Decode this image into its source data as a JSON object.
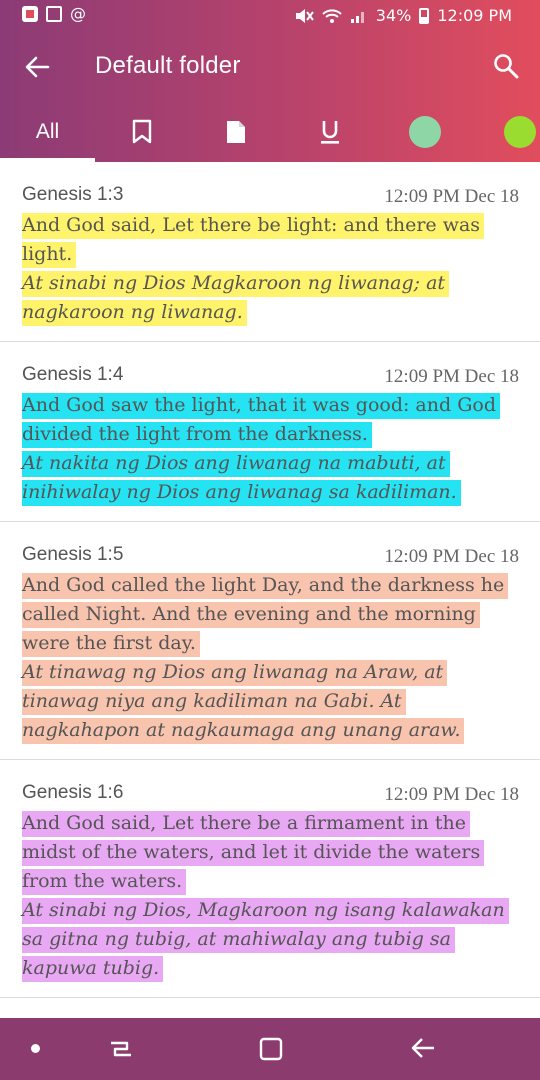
{
  "status_bar": {
    "battery_percent": "34%",
    "time": "12:09 PM"
  },
  "app_bar": {
    "title": "Default folder",
    "back_icon": "arrow-left-icon",
    "search_icon": "search-icon"
  },
  "tabs": {
    "all_label": "All",
    "items": [
      {
        "icon": "bookmark-icon"
      },
      {
        "icon": "note-icon"
      },
      {
        "icon": "underline-icon"
      },
      {
        "icon": "green-highlight-filter",
        "color": "#8fd6a6"
      },
      {
        "icon": "lime-highlight-filter",
        "color": "#9bdc31"
      }
    ]
  },
  "colors": {
    "header_left": "#8c3b76",
    "header_right": "#e14d5d",
    "navbar": "#8c3b6f"
  },
  "entries": [
    {
      "ref": "Genesis 1:3",
      "time": "12:09 PM Dec 18",
      "highlight": "#fff36b",
      "english": "And God said, Let there be light: and there was light.",
      "tagalog": "At sinabi ng Dios Magkaroon ng liwanag; at nagkaroon ng liwanag."
    },
    {
      "ref": "Genesis 1:4",
      "time": "12:09 PM Dec 18",
      "highlight": "#25e3f2",
      "english": "And God saw the light, that it was good: and God divided the light from the darkness.",
      "tagalog": "At nakita ng Dios ang liwanag na mabuti, at inihiwalay ng Dios ang liwanag sa kadiliman."
    },
    {
      "ref": "Genesis 1:5",
      "time": "12:09 PM Dec 18",
      "highlight": "#f8c4ae",
      "english": "And God called the light Day, and the darkness he called Night. And the evening and the morning were the first day.",
      "tagalog": "At tinawag ng Dios ang liwanag na Araw, at tinawag niya ang kadiliman na Gabi. At nagkahapon at nagkaumaga ang unang araw."
    },
    {
      "ref": "Genesis 1:6",
      "time": "12:09 PM Dec 18",
      "highlight": "#e9a8f4",
      "english": "And God said, Let there be a firmament in the midst of the waters, and let it divide the waters from the waters.",
      "tagalog": "At sinabi ng Dios, Magkaroon ng isang kalawakan sa gitna ng tubig, at mahiwalay ang tubig sa kapuwa tubig."
    }
  ]
}
